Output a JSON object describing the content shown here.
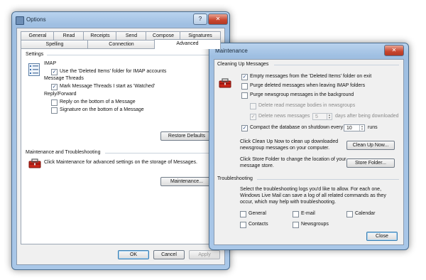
{
  "options": {
    "title": "Options",
    "tabs_row1": [
      "General",
      "Read",
      "Receipts",
      "Send",
      "Compose",
      "Signatures"
    ],
    "tabs_row2": [
      "Spelling",
      "Connection",
      "Advanced"
    ],
    "settings_title": "Settings",
    "imap_label": "IMAP",
    "imap_deleted": "Use the 'Deleted Items' folder for IMAP accounts",
    "threads_label": "Message Threads",
    "threads_mark": "Mark Message Threads I start as 'Watched'",
    "reply_label": "Reply/Forward",
    "reply_bottom": "Reply on the bottom of a Message",
    "sig_bottom": "Signature on the bottom of a Message",
    "restore_defaults": "Restore Defaults",
    "maint_title": "Maintenance and Troubleshooting",
    "maint_desc": "Click Maintenance for advanced settings on the storage of Messages.",
    "maint_button": "Maintenance...",
    "ok": "OK",
    "cancel": "Cancel",
    "apply": "Apply"
  },
  "maintenance": {
    "title": "Maintenance",
    "cleanup_title": "Cleaning Up Messages",
    "empty_deleted": "Empty messages from the 'Deleted Items' folder on exit",
    "purge_imap": "Purge deleted messages when leaving IMAP folders",
    "purge_news": "Purge newsgroup messages in the background",
    "delete_read": "Delete read message bodies in newsgroups",
    "delete_news": "Delete news messages",
    "delete_news_days": "5",
    "days_after": "days after being downloaded",
    "compact": "Compact the database on shutdown every",
    "compact_runs": "10",
    "runs": "runs",
    "cleanup_desc1": "Click Clean Up Now to clean up downloaded",
    "cleanup_desc2": "newsgroup messages on your computer.",
    "cleanup_button": "Clean Up Now...",
    "store_desc1": "Click Store Folder to change the location of your",
    "store_desc2": "message store.",
    "store_button": "Store Folder...",
    "troubleshoot_title": "Troubleshooting",
    "ts_desc1": "Select the troubleshooting logs you'd like to allow. For each one,",
    "ts_desc2": "Windows Live Mail can save a log of all related commands as they",
    "ts_desc3": "occur, which may help with troubleshooting.",
    "logs": [
      "General",
      "E-mail",
      "Calendar",
      "Contacts",
      "Newsgroups"
    ],
    "close": "Close"
  },
  "caption": {
    "help": "?",
    "close": "✕"
  },
  "checks": {
    "checked": "✓"
  }
}
